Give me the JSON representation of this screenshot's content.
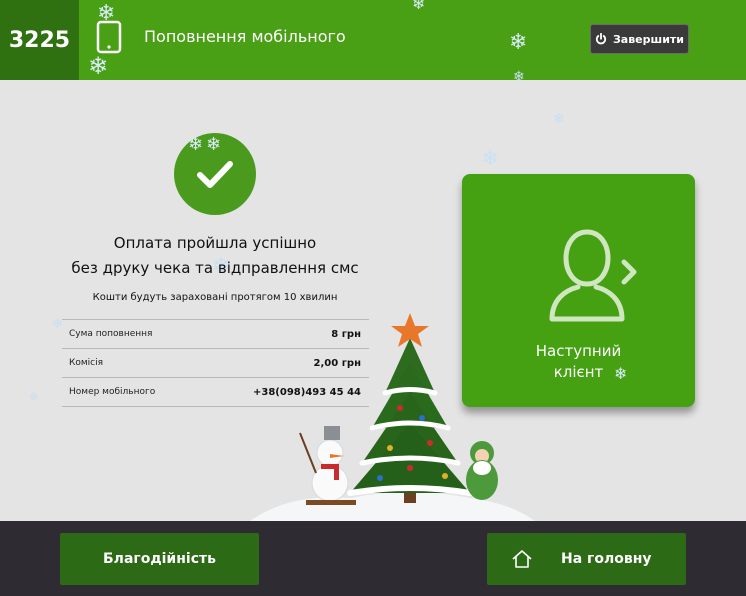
{
  "header": {
    "terminal_id": "3225",
    "title": "Поповнення мобільного",
    "exit_label": "Завершити"
  },
  "result": {
    "title_line1": "Оплата пройшла успішно",
    "title_line2": "без друку чека та відправлення смс",
    "note": "Кошти будуть зараховані протягом 10 хвилин",
    "details": [
      {
        "label": "Сума поповнення",
        "value": "8 грн"
      },
      {
        "label": "Комісія",
        "value": "2,00 грн"
      },
      {
        "label": "Номер мобільного",
        "value": "+38(098)493 45 44"
      }
    ]
  },
  "next_client": {
    "line1": "Наступний",
    "line2": "клієнт"
  },
  "footer": {
    "charity_label": "Благодійність",
    "home_label": "На головну"
  },
  "icons": {
    "success": "check-icon",
    "phone": "mobile-phone-icon",
    "exit": "power-icon",
    "next": "person-next-icon",
    "home": "home-icon",
    "decor": "snowflake-icon"
  },
  "colors": {
    "brand_green": "#49a015",
    "dark_green": "#2f7010",
    "button_green": "#2d6a15",
    "footer_bg": "#2e2b33",
    "page_bg": "#e4e4e4"
  }
}
